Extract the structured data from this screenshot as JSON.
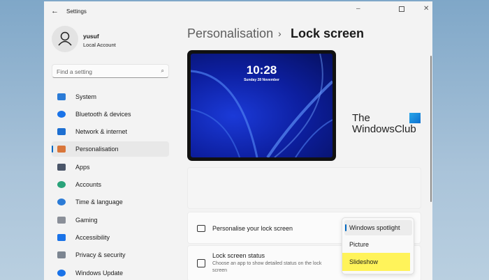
{
  "window": {
    "title": "Settings"
  },
  "user": {
    "name": "yusuf",
    "account_type": "Local Account"
  },
  "search": {
    "placeholder": "Find a setting"
  },
  "sidebar": {
    "items": [
      {
        "label": "System",
        "icon": "system-icon",
        "color": "#2b7bd6"
      },
      {
        "label": "Bluetooth & devices",
        "icon": "bluetooth-icon",
        "color": "#1a73e8"
      },
      {
        "label": "Network & internet",
        "icon": "wifi-icon",
        "color": "#1d6fd1"
      },
      {
        "label": "Personalisation",
        "icon": "brush-icon",
        "color": "#d9763a",
        "selected": true
      },
      {
        "label": "Apps",
        "icon": "apps-icon",
        "color": "#4a5568"
      },
      {
        "label": "Accounts",
        "icon": "accounts-icon",
        "color": "#2aa37a"
      },
      {
        "label": "Time & language",
        "icon": "globe-clock-icon",
        "color": "#2b7bd6"
      },
      {
        "label": "Gaming",
        "icon": "gamepad-icon",
        "color": "#8a8f98"
      },
      {
        "label": "Accessibility",
        "icon": "accessibility-icon",
        "color": "#1a73e8"
      },
      {
        "label": "Privacy & security",
        "icon": "shield-icon",
        "color": "#7c8591"
      },
      {
        "label": "Windows Update",
        "icon": "update-icon",
        "color": "#1a73e8"
      }
    ]
  },
  "breadcrumb": {
    "parent": "Personalisation",
    "separator": "›",
    "current": "Lock screen"
  },
  "preview": {
    "time": "10:28",
    "date": "Sunday 28 November"
  },
  "watermark": {
    "line1": "The",
    "line2": "WindowsClub"
  },
  "settings": [
    {
      "title": "Personalise your lock screen"
    },
    {
      "title": "Lock screen status",
      "description": "Choose an app to show detailed status on the lock screen"
    }
  ],
  "dropdown": {
    "options": [
      "Windows spotlight",
      "Picture",
      "Slideshow"
    ],
    "selected": "Windows spotlight",
    "highlighted": "Slideshow",
    "highlight_color": "#fff35a"
  }
}
